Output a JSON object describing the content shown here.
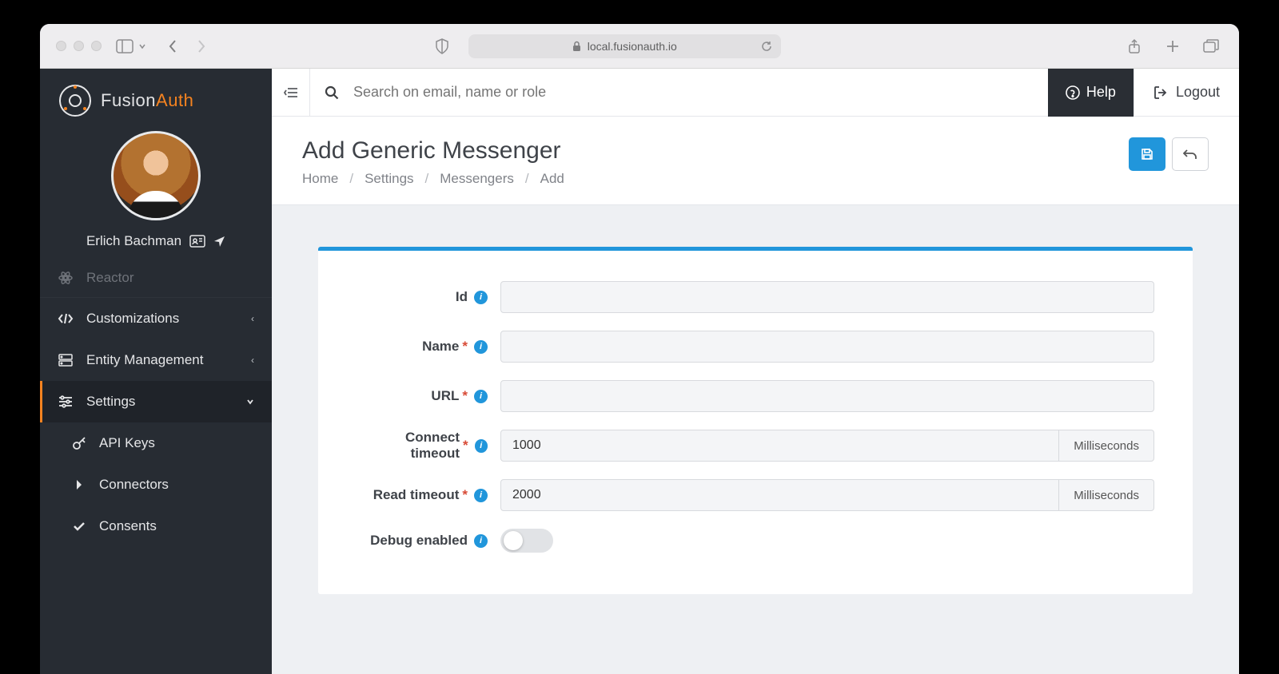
{
  "browser": {
    "address": "local.fusionauth.io"
  },
  "brand": {
    "name_primary": "Fusion",
    "name_secondary": "Auth"
  },
  "user": {
    "name": "Erlich Bachman"
  },
  "sidebar": {
    "reactor": "Reactor",
    "customizations": "Customizations",
    "entity_management": "Entity Management",
    "settings": "Settings",
    "api_keys": "API Keys",
    "connectors": "Connectors",
    "consents": "Consents"
  },
  "topbar": {
    "search_placeholder": "Search on email, name or role",
    "help": "Help",
    "logout": "Logout"
  },
  "page": {
    "title": "Add Generic Messenger",
    "breadcrumb": [
      "Home",
      "Settings",
      "Messengers",
      "Add"
    ]
  },
  "form": {
    "id": {
      "label": "Id",
      "value": ""
    },
    "name": {
      "label": "Name",
      "value": ""
    },
    "url": {
      "label": "URL",
      "value": ""
    },
    "connect_timeout": {
      "label": "Connect timeout",
      "value": "1000",
      "unit": "Milliseconds"
    },
    "read_timeout": {
      "label": "Read timeout",
      "value": "2000",
      "unit": "Milliseconds"
    },
    "debug": {
      "label": "Debug enabled",
      "value": false
    }
  }
}
